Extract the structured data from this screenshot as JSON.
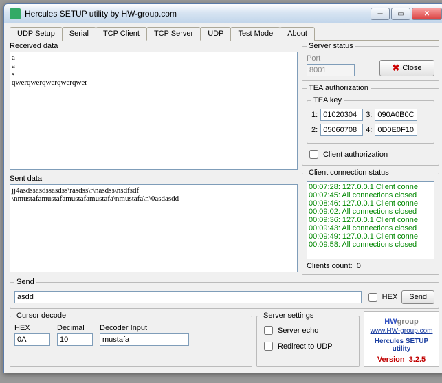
{
  "title": "Hercules SETUP utility by HW-group.com",
  "tabs": [
    "UDP Setup",
    "Serial",
    "TCP Client",
    "TCP Server",
    "UDP",
    "Test Mode",
    "About"
  ],
  "activeTab": 3,
  "labels": {
    "received": "Received data",
    "sent": "Sent data",
    "send": "Send",
    "hex": "HEX",
    "sendBtn": "Send",
    "serverStatus": "Server status",
    "port": "Port",
    "closeBtn": "Close",
    "teaAuth": "TEA authorization",
    "teaKey": "TEA key",
    "clientAuth": "Client authorization",
    "clientConn": "Client connection status",
    "clientsCount": "Clients count:",
    "cursorDecode": "Cursor decode",
    "hexCol": "HEX",
    "decCol": "Decimal",
    "decoderCol": "Decoder Input",
    "serverSettings": "Server settings",
    "serverEcho": "Server echo",
    "redirect": "Redirect to UDP",
    "version": "Version",
    "product": "Hercules SETUP utility",
    "url": "www.HW-group.com"
  },
  "receivedData": "a\na\ns\nqwerqwerqwerqwerqwer",
  "sentData": "jj4asdssasdssasdss\\rasdss\\r\\nasdss\\nsdfsdf\n\\nmustafamustafamustafamustafa\\nmustafa\\n\\0asdasdd",
  "sendValue": "asdd",
  "port": "8001",
  "tea": {
    "k1": "01020304",
    "k2": "05060708",
    "k3": "090A0B0C",
    "k4": "0D0E0F10"
  },
  "connLog": [
    "00:07:28: 127.0.0.1 Client conne",
    "00:07:45: All connections closed",
    "00:08:46: 127.0.0.1 Client conne",
    "00:09:02: All connections closed",
    "00:09:36: 127.0.0.1 Client conne",
    "00:09:43: All connections closed",
    "00:09:49: 127.0.0.1 Client conne",
    "00:09:58: All connections closed"
  ],
  "clientsCountVal": "0",
  "cursor": {
    "hex": "0A",
    "dec": "10",
    "decoder": "mustafa"
  },
  "versionNum": "3.2.5",
  "logo1": "HW",
  "logo2": "group"
}
